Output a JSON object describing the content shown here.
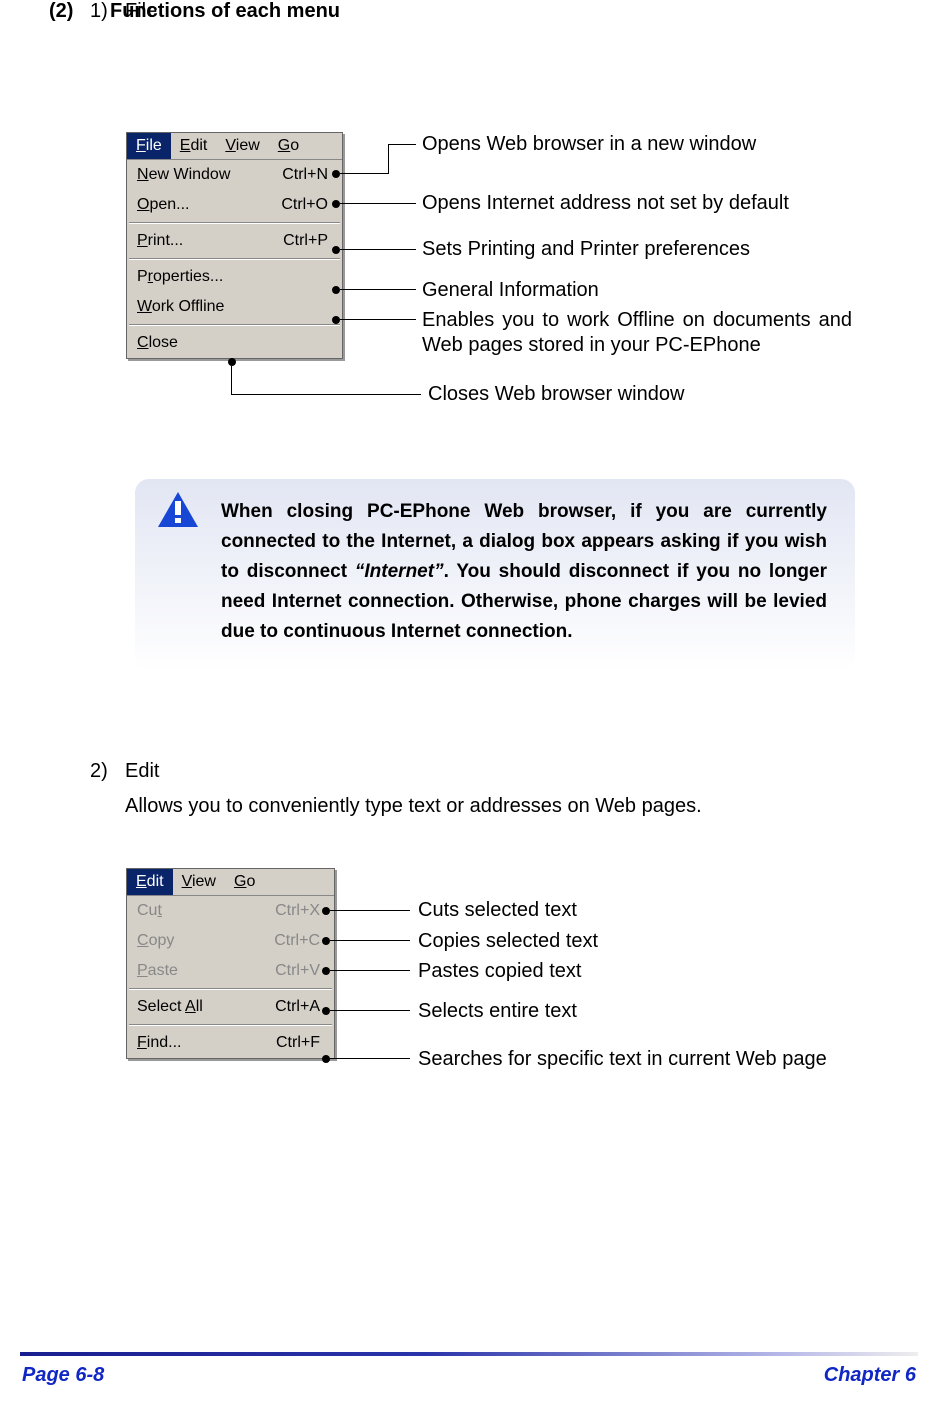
{
  "heading": {
    "num": "(2)",
    "text": "Functions of each menu"
  },
  "section1": {
    "num": "1)",
    "text": "File"
  },
  "section2": {
    "num": "2)",
    "text": "Edit",
    "desc": "Allows you to conveniently type text or addresses on Web pages."
  },
  "menubar": {
    "file": "File",
    "edit": "Edit",
    "view": "View",
    "go": "Go"
  },
  "file_menu": [
    {
      "label": "New Window",
      "u": "N",
      "shortcut": "Ctrl+N",
      "desc": "Opens Web browser in a new window"
    },
    {
      "label": "Open...",
      "u": "O",
      "shortcut": "Ctrl+O",
      "desc": "Opens Internet address not set by default"
    },
    {
      "sep": true
    },
    {
      "label": "Print...",
      "u": "P",
      "shortcut": "Ctrl+P",
      "desc": "Sets Printing and Printer preferences"
    },
    {
      "sep": true
    },
    {
      "label": "Properties...",
      "u": "r",
      "shortcut": "",
      "desc": "General Information"
    },
    {
      "label": "Work Offline",
      "u": "W",
      "shortcut": "",
      "desc": "Enables you to work Offline on documents and Web pages stored in your PC-EPhone"
    },
    {
      "sep": true
    },
    {
      "label": "Close",
      "u": "C",
      "shortcut": "",
      "desc": "Closes Web browser window"
    }
  ],
  "callout": {
    "t1": "When closing PC-EPhone Web browser, if you are currently connected to the Internet, a dialog box appears asking if you wish to disconnect ",
    "em": "“Internet”",
    "t2": ". You should disconnect if you no longer need Internet connection. Otherwise, phone charges will be levied due to continuous Internet connection."
  },
  "edit_menu": [
    {
      "label": "Cut",
      "u": "t",
      "shortcut": "Ctrl+X",
      "disabled": true,
      "desc": "Cuts selected text"
    },
    {
      "label": "Copy",
      "u": "C",
      "shortcut": "Ctrl+C",
      "disabled": true,
      "desc": "Copies selected text"
    },
    {
      "label": "Paste",
      "u": "P",
      "shortcut": "Ctrl+V",
      "disabled": true,
      "desc": "Pastes copied text"
    },
    {
      "sep": true
    },
    {
      "label": "Select All",
      "u": "A",
      "shortcut": "Ctrl+A",
      "disabled": false,
      "desc": "Selects entire text"
    },
    {
      "sep": true
    },
    {
      "label": "Find...",
      "u": "F",
      "shortcut": "Ctrl+F",
      "disabled": false,
      "desc": "Searches for specific text in current Web page"
    }
  ],
  "footer": {
    "left": "Page 6-8",
    "right": "Chapter 6"
  }
}
